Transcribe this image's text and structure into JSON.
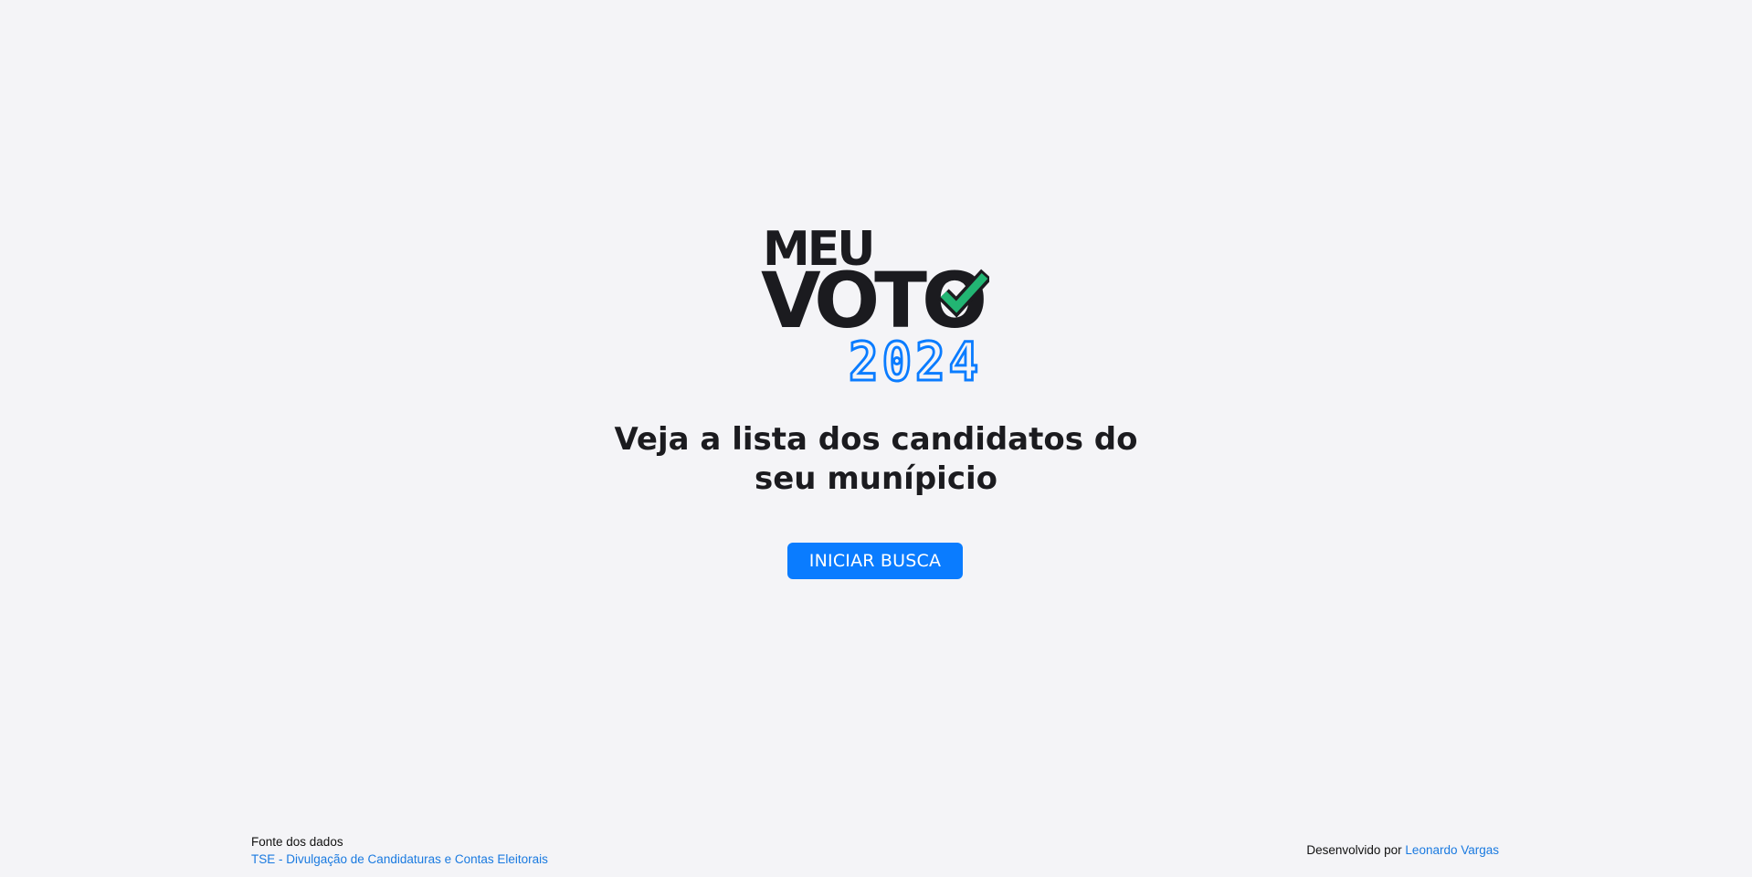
{
  "logo": {
    "line1": "MEU",
    "line2": "VOTO",
    "year": "2024",
    "check_icon": "check-icon",
    "colors": {
      "text": "#1b1b1f",
      "check": "#22b573",
      "year": "#0a7cff"
    }
  },
  "hero": {
    "headline_line1": "Veja a lista dos candidatos do",
    "headline_line2": "seu munípicio",
    "cta_label": "INICIAR BUSCA",
    "cta_color": "#0a7cff"
  },
  "footer": {
    "source_label": "Fonte dos dados",
    "source_link": "TSE - Divulgação de Candidaturas e Contas Eleitorais",
    "dev_prefix": "Desenvolvido por",
    "dev_link": "Leonardo Vargas",
    "link_color": "#1a7ae0"
  }
}
